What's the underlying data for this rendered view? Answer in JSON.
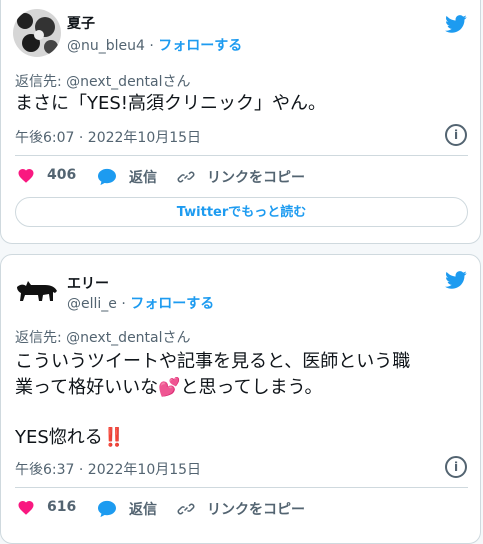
{
  "tweets": [
    {
      "name": "夏子",
      "handle": "@nu_bleu4",
      "follow_label": "フォローする",
      "reply_to": "返信先: @next_dentalさん",
      "text": "まさに「YES!高須クリニック」やん。",
      "timestamp": "午後6:07 · 2022年10月15日",
      "likes": "406",
      "reply_label": "返信",
      "copy_link_label": "リンクをコピー",
      "read_more_label": "Twitterでもっと読む"
    },
    {
      "name": "エリー",
      "handle": "@elli_e",
      "follow_label": "フォローする",
      "reply_to": "返信先: @next_dentalさん",
      "text_line1": "こういうツイートや記事を見ると、医師という職",
      "text_line2": "業って格好いいな💕と思ってしまう。",
      "text_line3": "YES惚れる‼️",
      "timestamp": "午後6:37 · 2022年10月15日",
      "likes": "616",
      "reply_label": "返信",
      "copy_link_label": "リンクをコピー"
    }
  ],
  "colors": {
    "accent": "#1d9bf0",
    "like": "#f91880",
    "muted": "#536471",
    "border": "#cfd9de"
  },
  "icons": [
    "twitter-bird-icon",
    "heart-icon",
    "reply-bubble-icon",
    "link-icon",
    "info-icon"
  ]
}
